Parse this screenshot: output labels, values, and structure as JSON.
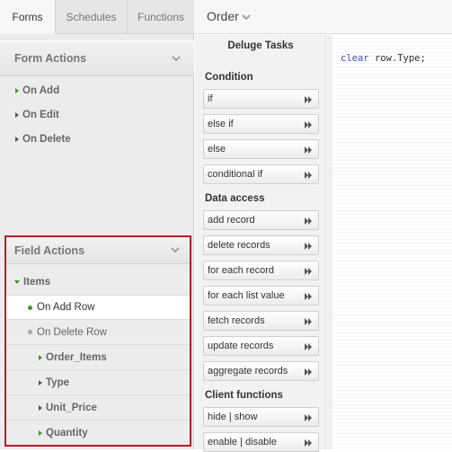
{
  "tabs": [
    {
      "label": "Forms",
      "active": true
    },
    {
      "label": "Schedules",
      "active": false
    },
    {
      "label": "Functions",
      "active": false
    }
  ],
  "form_title": "Order",
  "form_actions": {
    "header": "Form Actions",
    "items": [
      "On Add",
      "On Edit",
      "On Delete"
    ]
  },
  "field_actions": {
    "header": "Field Actions",
    "group": "Items",
    "rows": [
      "On Add Row",
      "On Delete Row"
    ],
    "fields": [
      "Order_Items",
      "Type",
      "Unit_Price",
      "Quantity"
    ]
  },
  "tasks": {
    "title": "Deluge Tasks",
    "categories": [
      {
        "name": "Condition",
        "items": [
          "if",
          "else if",
          "else",
          "conditional if"
        ]
      },
      {
        "name": "Data access",
        "items": [
          "add record",
          "delete records",
          "for each record",
          "for each list value",
          "fetch records",
          "update records",
          "aggregate records"
        ]
      },
      {
        "name": "Client functions",
        "items": [
          "hide | show",
          "enable | disable"
        ]
      }
    ]
  },
  "code": {
    "keyword": "clear",
    "rest": " row.Type;"
  },
  "colors": {
    "highlight_border": "#b82025",
    "green_marker": "#3a9c1f",
    "keyword": "#3b52b5"
  }
}
